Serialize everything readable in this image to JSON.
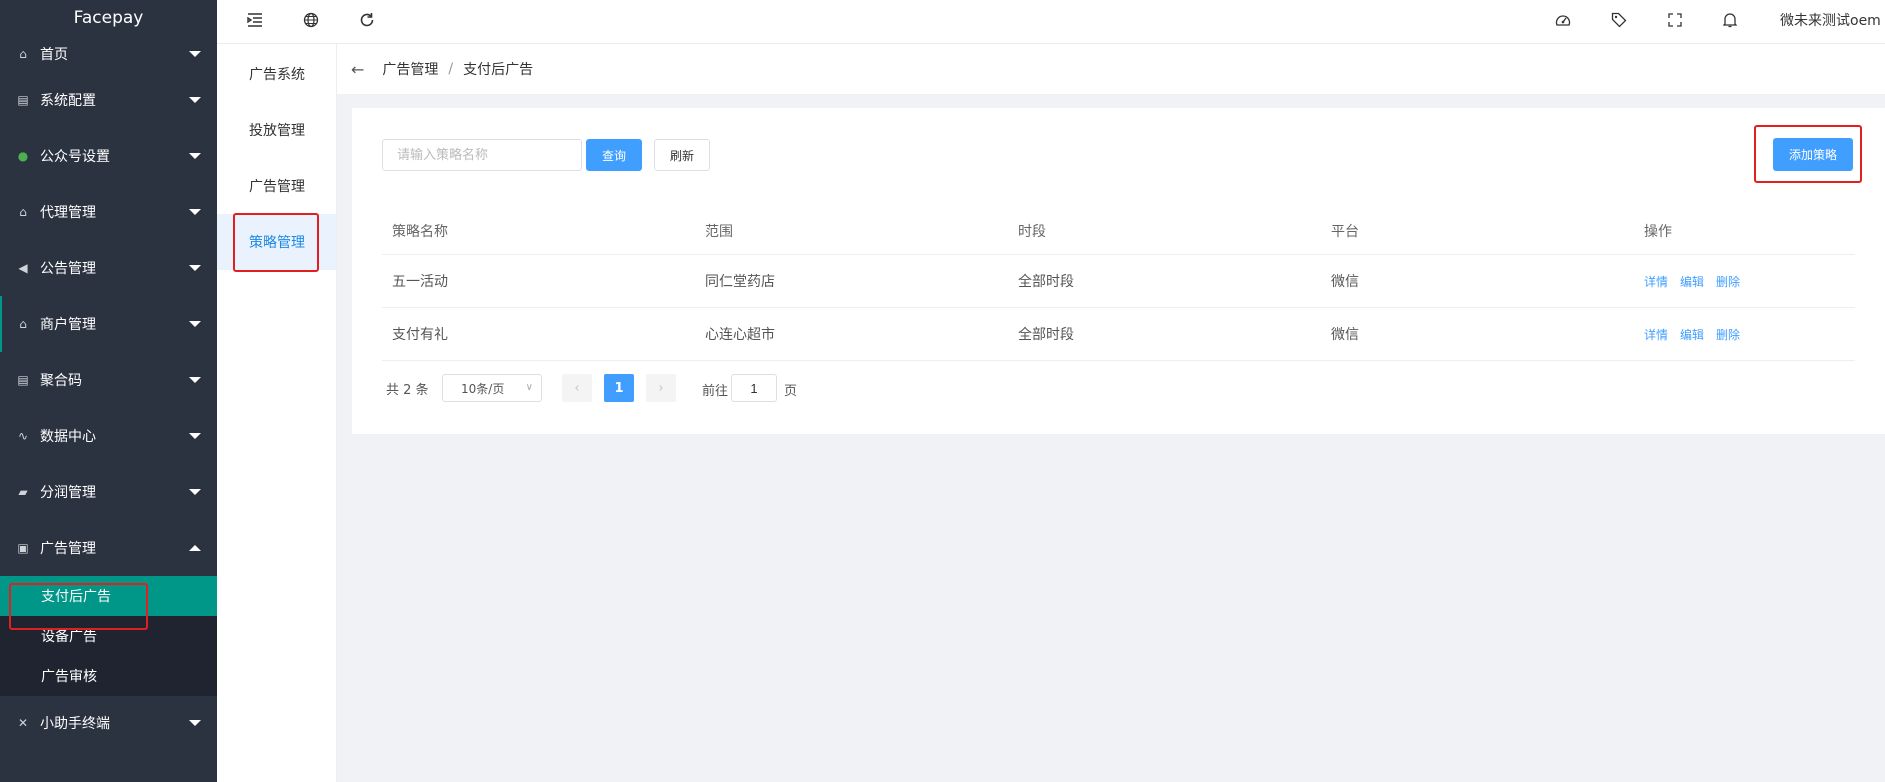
{
  "app": {
    "logo": "Facepay"
  },
  "sidebar": {
    "items": [
      {
        "label": "首页",
        "icon": "home-icon",
        "glyph": "⌂"
      },
      {
        "label": "系统配置",
        "icon": "config-icon",
        "glyph": "▤"
      },
      {
        "label": "公众号设置",
        "icon": "wechat-icon",
        "glyph": "●"
      },
      {
        "label": "代理管理",
        "icon": "home-icon",
        "glyph": "⌂"
      },
      {
        "label": "公告管理",
        "icon": "speaker-icon",
        "glyph": "◀"
      },
      {
        "label": "商户管理",
        "icon": "home-icon",
        "glyph": "⌂"
      },
      {
        "label": "聚合码",
        "icon": "config-icon",
        "glyph": "▤"
      },
      {
        "label": "数据中心",
        "icon": "pulse-icon",
        "glyph": "∿"
      },
      {
        "label": "分润管理",
        "icon": "wallet-icon",
        "glyph": "▰"
      },
      {
        "label": "广告管理",
        "icon": "document-icon",
        "glyph": "▣"
      }
    ],
    "ad_sub_items": [
      {
        "label": "支付后广告"
      },
      {
        "label": "设备广告"
      },
      {
        "label": "广告审核"
      }
    ],
    "assistant": {
      "label": "小助手终端",
      "icon": "tools-icon",
      "glyph": "✕"
    }
  },
  "header": {
    "user_name": "微未来测试oem",
    "icons": [
      "collapse-menu-icon",
      "globe-icon",
      "refresh-icon",
      "theme-icon",
      "tag-icon",
      "fullscreen-icon",
      "bell-icon"
    ]
  },
  "subnav": {
    "items": [
      {
        "label": "广告系统"
      },
      {
        "label": "投放管理"
      },
      {
        "label": "广告管理"
      },
      {
        "label": "策略管理"
      }
    ]
  },
  "breadcrumb": {
    "level1": "广告管理",
    "separator": "/",
    "level2": "支付后广告"
  },
  "toolbar": {
    "search_placeholder": "请输入策略名称",
    "query_label": "查询",
    "refresh_label": "刷新",
    "add_label": "添加策略"
  },
  "table": {
    "columns": [
      "策略名称",
      "范围",
      "时段",
      "平台",
      "操作"
    ],
    "rows": [
      {
        "name": "五一活动",
        "scope": "同仁堂药店",
        "period": "全部时段",
        "platform": "微信"
      },
      {
        "name": "支付有礼",
        "scope": "心连心超市",
        "period": "全部时段",
        "platform": "微信"
      }
    ],
    "actions": {
      "detail": "详情",
      "edit": "编辑",
      "delete": "删除"
    }
  },
  "pagination": {
    "total_text": "共 2 条",
    "page_size": "10条/页",
    "current_page": "1",
    "goto_label": "前往",
    "goto_value": "1",
    "page_unit": "页"
  },
  "colors": {
    "sidebar_bg": "#2b3240",
    "active_teal": "#009688",
    "primary_blue": "#409eff",
    "highlight_red": "#e02020"
  }
}
